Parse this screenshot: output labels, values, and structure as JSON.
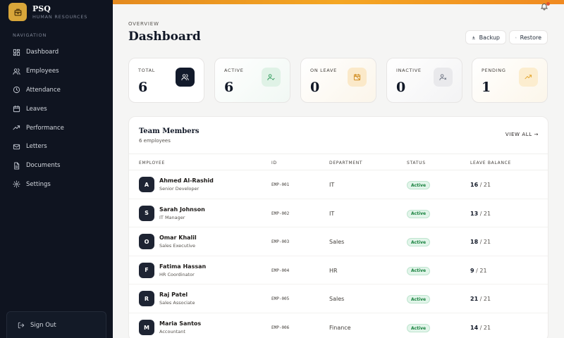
{
  "brand": {
    "name": "PSQ",
    "subtitle": "HUMAN RESOURCES"
  },
  "sidebar": {
    "section_label": "NAVIGATION",
    "items": [
      {
        "label": "Dashboard",
        "icon": "grid-icon"
      },
      {
        "label": "Employees",
        "icon": "users-icon"
      },
      {
        "label": "Attendance",
        "icon": "clock-icon"
      },
      {
        "label": "Leaves",
        "icon": "calendar-icon"
      },
      {
        "label": "Performance",
        "icon": "trend-icon"
      },
      {
        "label": "Letters",
        "icon": "mail-icon"
      },
      {
        "label": "Documents",
        "icon": "document-icon"
      },
      {
        "label": "Settings",
        "icon": "gear-icon"
      }
    ],
    "sign_out": "Sign Out"
  },
  "header": {
    "eyebrow": "OVERVIEW",
    "title": "Dashboard",
    "backup_label": "Backup",
    "restore_label": "Restore"
  },
  "stats": [
    {
      "label": "TOTAL",
      "value": "6",
      "icon": "users-icon"
    },
    {
      "label": "ACTIVE",
      "value": "6",
      "icon": "user-check-icon"
    },
    {
      "label": "ON LEAVE",
      "value": "0",
      "icon": "calendar-off-icon"
    },
    {
      "label": "INACTIVE",
      "value": "0",
      "icon": "user-x-icon"
    },
    {
      "label": "PENDING",
      "value": "1",
      "icon": "trend-icon"
    }
  ],
  "team": {
    "title": "Team Members",
    "subtitle": "6 employees",
    "view_all": "VIEW ALL →",
    "columns": [
      "EMPLOYEE",
      "ID",
      "DEPARTMENT",
      "STATUS",
      "LEAVE BALANCE"
    ],
    "rows": [
      {
        "initial": "A",
        "name": "Ahmed Al-Rashid",
        "role": "Senior Developer",
        "id": "EMP-001",
        "dept": "IT",
        "status": "Active",
        "leave_used": "16",
        "leave_total": "/ 21"
      },
      {
        "initial": "S",
        "name": "Sarah Johnson",
        "role": "IT Manager",
        "id": "EMP-002",
        "dept": "IT",
        "status": "Active",
        "leave_used": "13",
        "leave_total": "/ 21"
      },
      {
        "initial": "O",
        "name": "Omar Khalil",
        "role": "Sales Executive",
        "id": "EMP-003",
        "dept": "Sales",
        "status": "Active",
        "leave_used": "18",
        "leave_total": "/ 21"
      },
      {
        "initial": "F",
        "name": "Fatima Hassan",
        "role": "HR Coordinator",
        "id": "EMP-004",
        "dept": "HR",
        "status": "Active",
        "leave_used": "9",
        "leave_total": "/ 21"
      },
      {
        "initial": "R",
        "name": "Raj Patel",
        "role": "Sales Associate",
        "id": "EMP-005",
        "dept": "Sales",
        "status": "Active",
        "leave_used": "21",
        "leave_total": "/ 21"
      },
      {
        "initial": "M",
        "name": "Maria Santos",
        "role": "Accountant",
        "id": "EMP-006",
        "dept": "Finance",
        "status": "Active",
        "leave_used": "14",
        "leave_total": "/ 21"
      }
    ]
  },
  "colors": {
    "accent": "#f4a623",
    "sidebar_bg": "#0f1420",
    "active_badge": "#16803c",
    "notification": "#e0522e"
  }
}
